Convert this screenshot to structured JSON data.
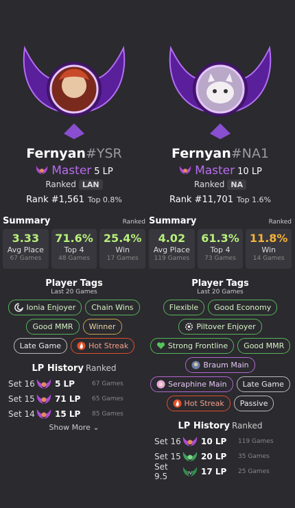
{
  "players": [
    {
      "name": "Fernyan",
      "tag": "#YSR",
      "tier": "Master",
      "lp": "5 LP",
      "queue": "Ranked",
      "region": "LAN",
      "rank_position": "Rank #1,561",
      "top_percent": "Top 0.8%",
      "summary_title": "Summary",
      "summary_sub": "Ranked",
      "stats": [
        {
          "value": "3.33",
          "label": "Avg Place",
          "games": "67 Games",
          "color": "#b7f07a"
        },
        {
          "value": "71.6%",
          "label": "Top 4",
          "games": "48 Games",
          "color": "#b7f07a"
        },
        {
          "value": "25.4%",
          "label": "Win",
          "games": "17 Games",
          "color": "#b7f07a"
        }
      ],
      "tags_title": "Player Tags",
      "tags_sub": "Last 20 Games",
      "tags": [
        {
          "label": "Ionia Enjoyer",
          "style": "green",
          "icon": "swirl-icon"
        },
        {
          "label": "Chain Wins",
          "style": "green"
        },
        {
          "label": "Good MMR",
          "style": "green"
        },
        {
          "label": "Winner",
          "style": "gold"
        },
        {
          "label": "Late Game",
          "style": "gray"
        },
        {
          "label": "Hot Streak",
          "style": "orange",
          "icon": "flame-icon"
        }
      ],
      "history_title": "LP History",
      "history_sub": "Ranked",
      "history": [
        {
          "set": "Set 16",
          "lp": "5 LP",
          "games": "67 Games",
          "emblem": "master"
        },
        {
          "set": "Set 15",
          "lp": "71 LP",
          "games": "65 Games",
          "emblem": "master"
        },
        {
          "set": "Set 14",
          "lp": "15 LP",
          "games": "85 Games",
          "emblem": "master"
        }
      ],
      "show_more": "Show More ⌄"
    },
    {
      "name": "Fernyan",
      "tag": "#NA1",
      "tier": "Master",
      "lp": "10 LP",
      "queue": "Ranked",
      "region": "NA",
      "rank_position": "Rank #11,701",
      "top_percent": "Top 1.6%",
      "summary_title": "Summary",
      "summary_sub": "Ranked",
      "stats": [
        {
          "value": "4.02",
          "label": "Avg Place",
          "games": "119 Games",
          "color": "#b7f07a"
        },
        {
          "value": "61.3%",
          "label": "Top 4",
          "games": "73 Games",
          "color": "#b7f07a"
        },
        {
          "value": "11.8%",
          "label": "Win",
          "games": "14 Games",
          "color": "#f3b13b"
        }
      ],
      "tags_title": "Player Tags",
      "tags_sub": "Last 20 Games",
      "tags": [
        {
          "label": "Flexible",
          "style": "green"
        },
        {
          "label": "Good Economy",
          "style": "green"
        },
        {
          "label": "Piltover Enjoyer",
          "style": "green",
          "icon": "gear-icon"
        },
        {
          "label": "Strong Frontline",
          "style": "green",
          "icon": "heart-icon"
        },
        {
          "label": "Good MMR",
          "style": "green"
        },
        {
          "label": "Braum Main",
          "style": "purple",
          "icon": "champion-portrait-icon"
        },
        {
          "label": "Seraphine Main",
          "style": "purple",
          "icon": "champion-portrait-icon"
        },
        {
          "label": "Late Game",
          "style": "gray"
        },
        {
          "label": "Hot Streak",
          "style": "orange",
          "icon": "flame-icon"
        },
        {
          "label": "Passive",
          "style": "gray"
        }
      ],
      "history_title": "LP History",
      "history_sub": "Ranked",
      "history": [
        {
          "set": "Set 16",
          "lp": "10 LP",
          "games": "119 Games",
          "emblem": "master"
        },
        {
          "set": "Set 15",
          "lp": "20 LP",
          "games": "35 Games",
          "emblem": "diamond"
        },
        {
          "set": "Set 9.5",
          "lp": "17 LP",
          "games": "25 Games",
          "emblem": "emerald"
        }
      ]
    }
  ]
}
